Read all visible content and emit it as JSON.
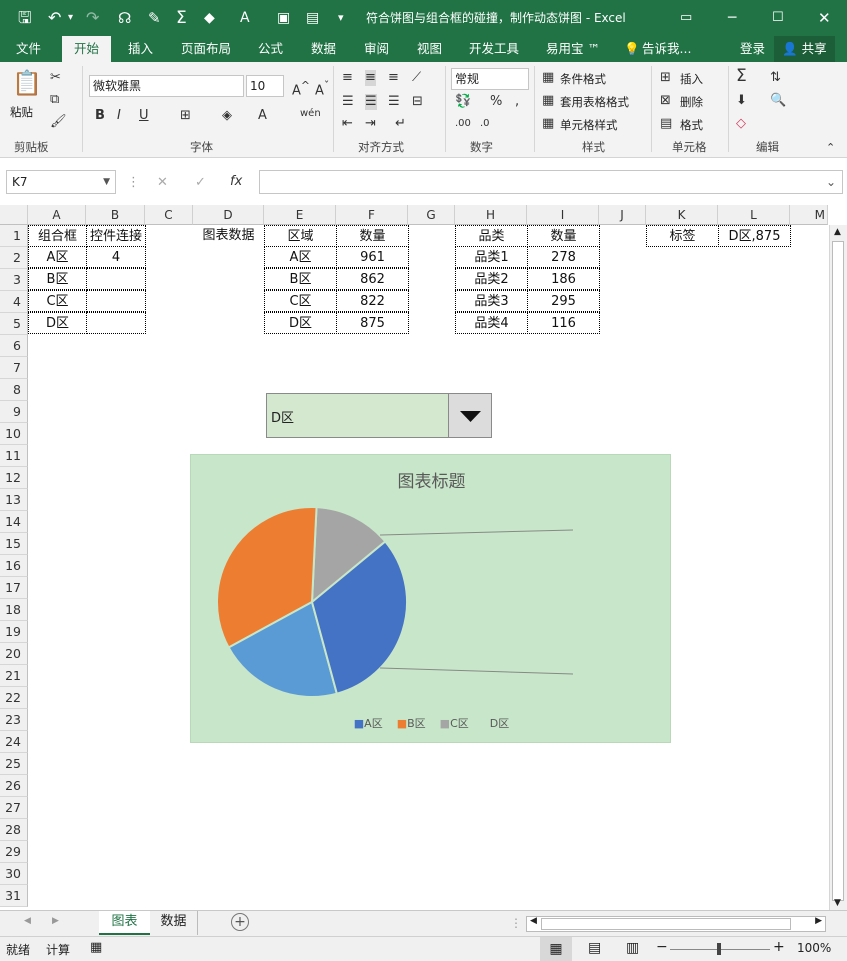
{
  "window": {
    "title": "符合饼图与组合框的碰撞，制作动态饼图 - Excel"
  },
  "tabs": [
    "文件",
    "开始",
    "插入",
    "页面布局",
    "公式",
    "数据",
    "审阅",
    "视图",
    "开发工具",
    "易用宝 ™"
  ],
  "tell_me": "告诉我...",
  "login": "登录",
  "share": "共享",
  "ribbon": {
    "paste": "粘贴",
    "font_name": "微软雅黑",
    "font_size": "10",
    "number_format": "常规",
    "bold": "B",
    "italic": "I",
    "underline": "U",
    "cond_format": "条件格式",
    "table_format": "套用表格格式",
    "cell_style": "单元格样式",
    "insert": "插入",
    "delete": "删除",
    "format": "格式",
    "groups": [
      "剪贴板",
      "字体",
      "对齐方式",
      "数字",
      "样式",
      "单元格",
      "编辑"
    ]
  },
  "namebox": "K7",
  "formula": "",
  "columns": [
    "A",
    "B",
    "C",
    "D",
    "E",
    "F",
    "G",
    "H",
    "I",
    "J",
    "K",
    "L",
    "M"
  ],
  "rows": [
    "1",
    "2",
    "3",
    "4",
    "5",
    "6",
    "7",
    "8",
    "9",
    "10",
    "11",
    "12",
    "13",
    "14",
    "15",
    "16",
    "17",
    "18",
    "19",
    "20",
    "21",
    "22",
    "23",
    "24",
    "25",
    "26",
    "27",
    "28",
    "29",
    "30",
    "31"
  ],
  "table1": {
    "h1": "组合框",
    "h2": "控件连接",
    "r1": "A区",
    "r2": "B区",
    "r3": "C区",
    "r4": "D区",
    "link": "4"
  },
  "chart_label": "图表数据",
  "table2": {
    "h1": "区域",
    "h2": "数量",
    "rows": [
      [
        "A区",
        "961"
      ],
      [
        "B区",
        "862"
      ],
      [
        "C区",
        "822"
      ],
      [
        "D区",
        "875"
      ]
    ]
  },
  "table3": {
    "h1": "品类",
    "h2": "数量",
    "rows": [
      [
        "品类1",
        "278"
      ],
      [
        "品类2",
        "186"
      ],
      [
        "品类3",
        "295"
      ],
      [
        "品类4",
        "116"
      ]
    ]
  },
  "tag": {
    "h": "标签",
    "v": "D区,875"
  },
  "combo_value": "D区",
  "colors": {
    "excel_green": "#217346",
    "chart_bg": "#c8e6c9",
    "combo_bg": "#d4e8d0",
    "a": "#4472c4",
    "b": "#ed7d31",
    "c": "#a5a5a5",
    "d": "#5b9bd5"
  },
  "chart_data": {
    "type": "pie",
    "title": "图表标题",
    "legend": [
      "A区",
      "B区",
      "C区",
      "D区"
    ],
    "slices": [
      {
        "name": "A区",
        "value": 278,
        "color": "#4472c4"
      },
      {
        "name": "B区",
        "value": 186,
        "color": "#5b9bd5"
      },
      {
        "name": "C区",
        "value": 295,
        "color": "#ed7d31"
      },
      {
        "name": "D区",
        "value": 116,
        "color": "#a5a5a5"
      }
    ],
    "legend_placement": "bottom"
  },
  "sheets": [
    "图表",
    "数据"
  ],
  "status": {
    "ready": "就绪",
    "calc": "计算",
    "zoom": "100%"
  }
}
